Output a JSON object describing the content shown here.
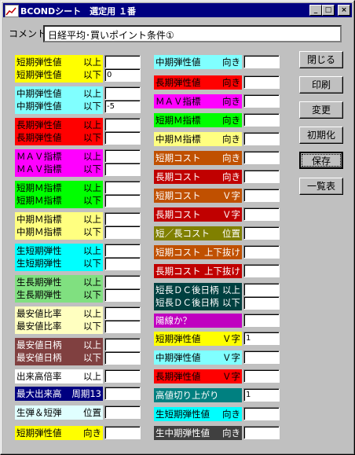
{
  "window": {
    "title": "BCONDシート　選定用 １番",
    "minimize": "_",
    "maximize": "□",
    "close": "×"
  },
  "comment": {
    "label": "コメント",
    "value": "日経平均･買いポイント条件①"
  },
  "left_conditions": [
    {
      "id": "L1",
      "line1": "短期弾性値",
      "op1": "以上",
      "line2": "短期弾性値",
      "op2": "以下",
      "v1": "",
      "v2": "0",
      "bg": "#ffff00",
      "fg": "#000000"
    },
    {
      "id": "L2",
      "line1": "中期弾性値",
      "op1": "以上",
      "line2": "中期弾性値",
      "op2": "以下",
      "v1": "",
      "v2": "-5",
      "bg": "#80ffff",
      "fg": "#000000"
    },
    {
      "id": "L3",
      "line1": "長期弾性値",
      "op1": "以上",
      "line2": "長期弾性値",
      "op2": "以下",
      "v1": "",
      "v2": "",
      "bg": "#ff0000",
      "fg": "#000000"
    },
    {
      "id": "L4",
      "line1": "ＭＡＶ指標",
      "op1": "以上",
      "line2": "ＭＡＶ指標",
      "op2": "以下",
      "v1": "",
      "v2": "",
      "bg": "#ff00ff",
      "fg": "#000000"
    },
    {
      "id": "L5",
      "line1": "短期Ｍ指標",
      "op1": "以上",
      "line2": "短期Ｍ指標",
      "op2": "以下",
      "v1": "",
      "v2": "",
      "bg": "#00ff00",
      "fg": "#000000"
    },
    {
      "id": "L6",
      "line1": "中期Ｍ指標",
      "op1": "以上",
      "line2": "中期Ｍ指標",
      "op2": "以下",
      "v1": "",
      "v2": "",
      "bg": "#ffff80",
      "fg": "#000000"
    },
    {
      "id": "L7",
      "line1": "生短期弾性",
      "op1": "以上",
      "line2": "生短期弾性",
      "op2": "以下",
      "v1": "",
      "v2": "",
      "bg": "#00ffff",
      "fg": "#000000"
    },
    {
      "id": "L8",
      "line1": "生長期弾性",
      "op1": "以上",
      "line2": "生長期弾性",
      "op2": "以下",
      "v1": "",
      "v2": "",
      "bg": "#80e080",
      "fg": "#000000"
    },
    {
      "id": "L9",
      "line1": "最安値比率",
      "op1": "以上",
      "line2": "最安値比率",
      "op2": "以下",
      "v1": "",
      "v2": "",
      "bg": "#ffffc0",
      "fg": "#000000"
    },
    {
      "id": "L10",
      "line1": "最安値日柄",
      "op1": "以上",
      "line2": "最安値日柄",
      "op2": "以下",
      "v1": "",
      "v2": "",
      "bg": "#804040",
      "fg": "#ffffff"
    }
  ],
  "left_single": [
    {
      "id": "L11",
      "label": "出来高倍率",
      "op": "以上",
      "v": "",
      "bg": "#ffffff",
      "fg": "#000000"
    },
    {
      "id": "L12",
      "label": "最大出来高",
      "op": "周期13",
      "v": "",
      "bg": "#000080",
      "fg": "#ffffff"
    },
    {
      "id": "L13",
      "label": "生弾＆短弾",
      "op": "位置",
      "v": "",
      "bg": "#e0ffff",
      "fg": "#000000"
    },
    {
      "id": "L14",
      "label": "短期弾性値",
      "op": "向き",
      "v": "",
      "bg": "#ffff00",
      "fg": "#000000"
    }
  ],
  "right_items": [
    {
      "id": "R1",
      "label": "中期弾性値",
      "op": "向き",
      "v": "",
      "bg": "#80ffff",
      "fg": "#000000"
    },
    {
      "id": "R2",
      "label": "長期弾性値",
      "op": "向き",
      "v": "",
      "bg": "#ff0000",
      "fg": "#000000"
    },
    {
      "id": "R3",
      "label": "ＭＡＶ指標",
      "op": "向き",
      "v": "",
      "bg": "#ff00ff",
      "fg": "#000000"
    },
    {
      "id": "R4",
      "label": "短期Ｍ指標",
      "op": "向き",
      "v": "",
      "bg": "#00ff00",
      "fg": "#000000"
    },
    {
      "id": "R5",
      "label": "中期Ｍ指標",
      "op": "向き",
      "v": "",
      "bg": "#ffff80",
      "fg": "#000000"
    },
    {
      "id": "R6",
      "label": "短期コスト",
      "op": "向き",
      "v": "",
      "bg": "#c05000",
      "fg": "#ffffff"
    },
    {
      "id": "R7",
      "label": "長期コスト",
      "op": "向き",
      "v": "",
      "bg": "#c00000",
      "fg": "#ffffff"
    },
    {
      "id": "R8",
      "label": "短期コスト",
      "op": "Ｖ字",
      "v": "",
      "bg": "#c05000",
      "fg": "#ffffff"
    },
    {
      "id": "R9",
      "label": "長期コスト",
      "op": "Ｖ字",
      "v": "",
      "bg": "#c00000",
      "fg": "#ffffff"
    },
    {
      "id": "R10",
      "label": "短／長コスト",
      "op": "位置",
      "v": "",
      "bg": "#808000",
      "fg": "#ffffff"
    },
    {
      "id": "R11",
      "label": "短期コスト",
      "op": "上下抜け",
      "v": "",
      "bg": "#c05000",
      "fg": "#ffffff"
    },
    {
      "id": "R12",
      "label": "長期コスト",
      "op": "上下抜け",
      "v": "",
      "bg": "#c00000",
      "fg": "#ffffff"
    }
  ],
  "right_double": {
    "id": "R13",
    "line1": "短長ＤＣ後日柄",
    "op1": "以上",
    "line2": "短長ＤＣ後日柄",
    "op2": "以下",
    "v1": "",
    "v2": "",
    "bg": "#004040",
    "fg": "#ffffff"
  },
  "right_items2": [
    {
      "id": "R14",
      "label": "陽線か？",
      "op": "",
      "v": "",
      "bg": "#c000c0",
      "fg": "#ffffff"
    },
    {
      "id": "R15",
      "label": "短期弾性値",
      "op": "Ｖ字",
      "v": "1",
      "bg": "#ffff00",
      "fg": "#000000"
    },
    {
      "id": "R16",
      "label": "中期弾性値",
      "op": "Ｖ字",
      "v": "",
      "bg": "#80ffff",
      "fg": "#000000"
    },
    {
      "id": "R17",
      "label": "長期弾性値",
      "op": "Ｖ字",
      "v": "",
      "bg": "#ff0000",
      "fg": "#000000"
    },
    {
      "id": "R18",
      "label": "高値切り上がり",
      "op": "",
      "v": "1",
      "bg": "#008080",
      "fg": "#ffffff"
    },
    {
      "id": "R19",
      "label": "生短期弾性値",
      "op": "向き",
      "v": "",
      "bg": "#00ffff",
      "fg": "#000000"
    },
    {
      "id": "R20",
      "label": "生中期弾性値",
      "op": "向き",
      "v": "",
      "bg": "#404040",
      "fg": "#ffffff"
    }
  ],
  "buttons": [
    {
      "id": "close",
      "label": "閉じる"
    },
    {
      "id": "print",
      "label": "印刷"
    },
    {
      "id": "change",
      "label": "変更"
    },
    {
      "id": "init",
      "label": "初期化"
    },
    {
      "id": "save",
      "label": "保存"
    },
    {
      "id": "list",
      "label": "一覧表"
    }
  ]
}
